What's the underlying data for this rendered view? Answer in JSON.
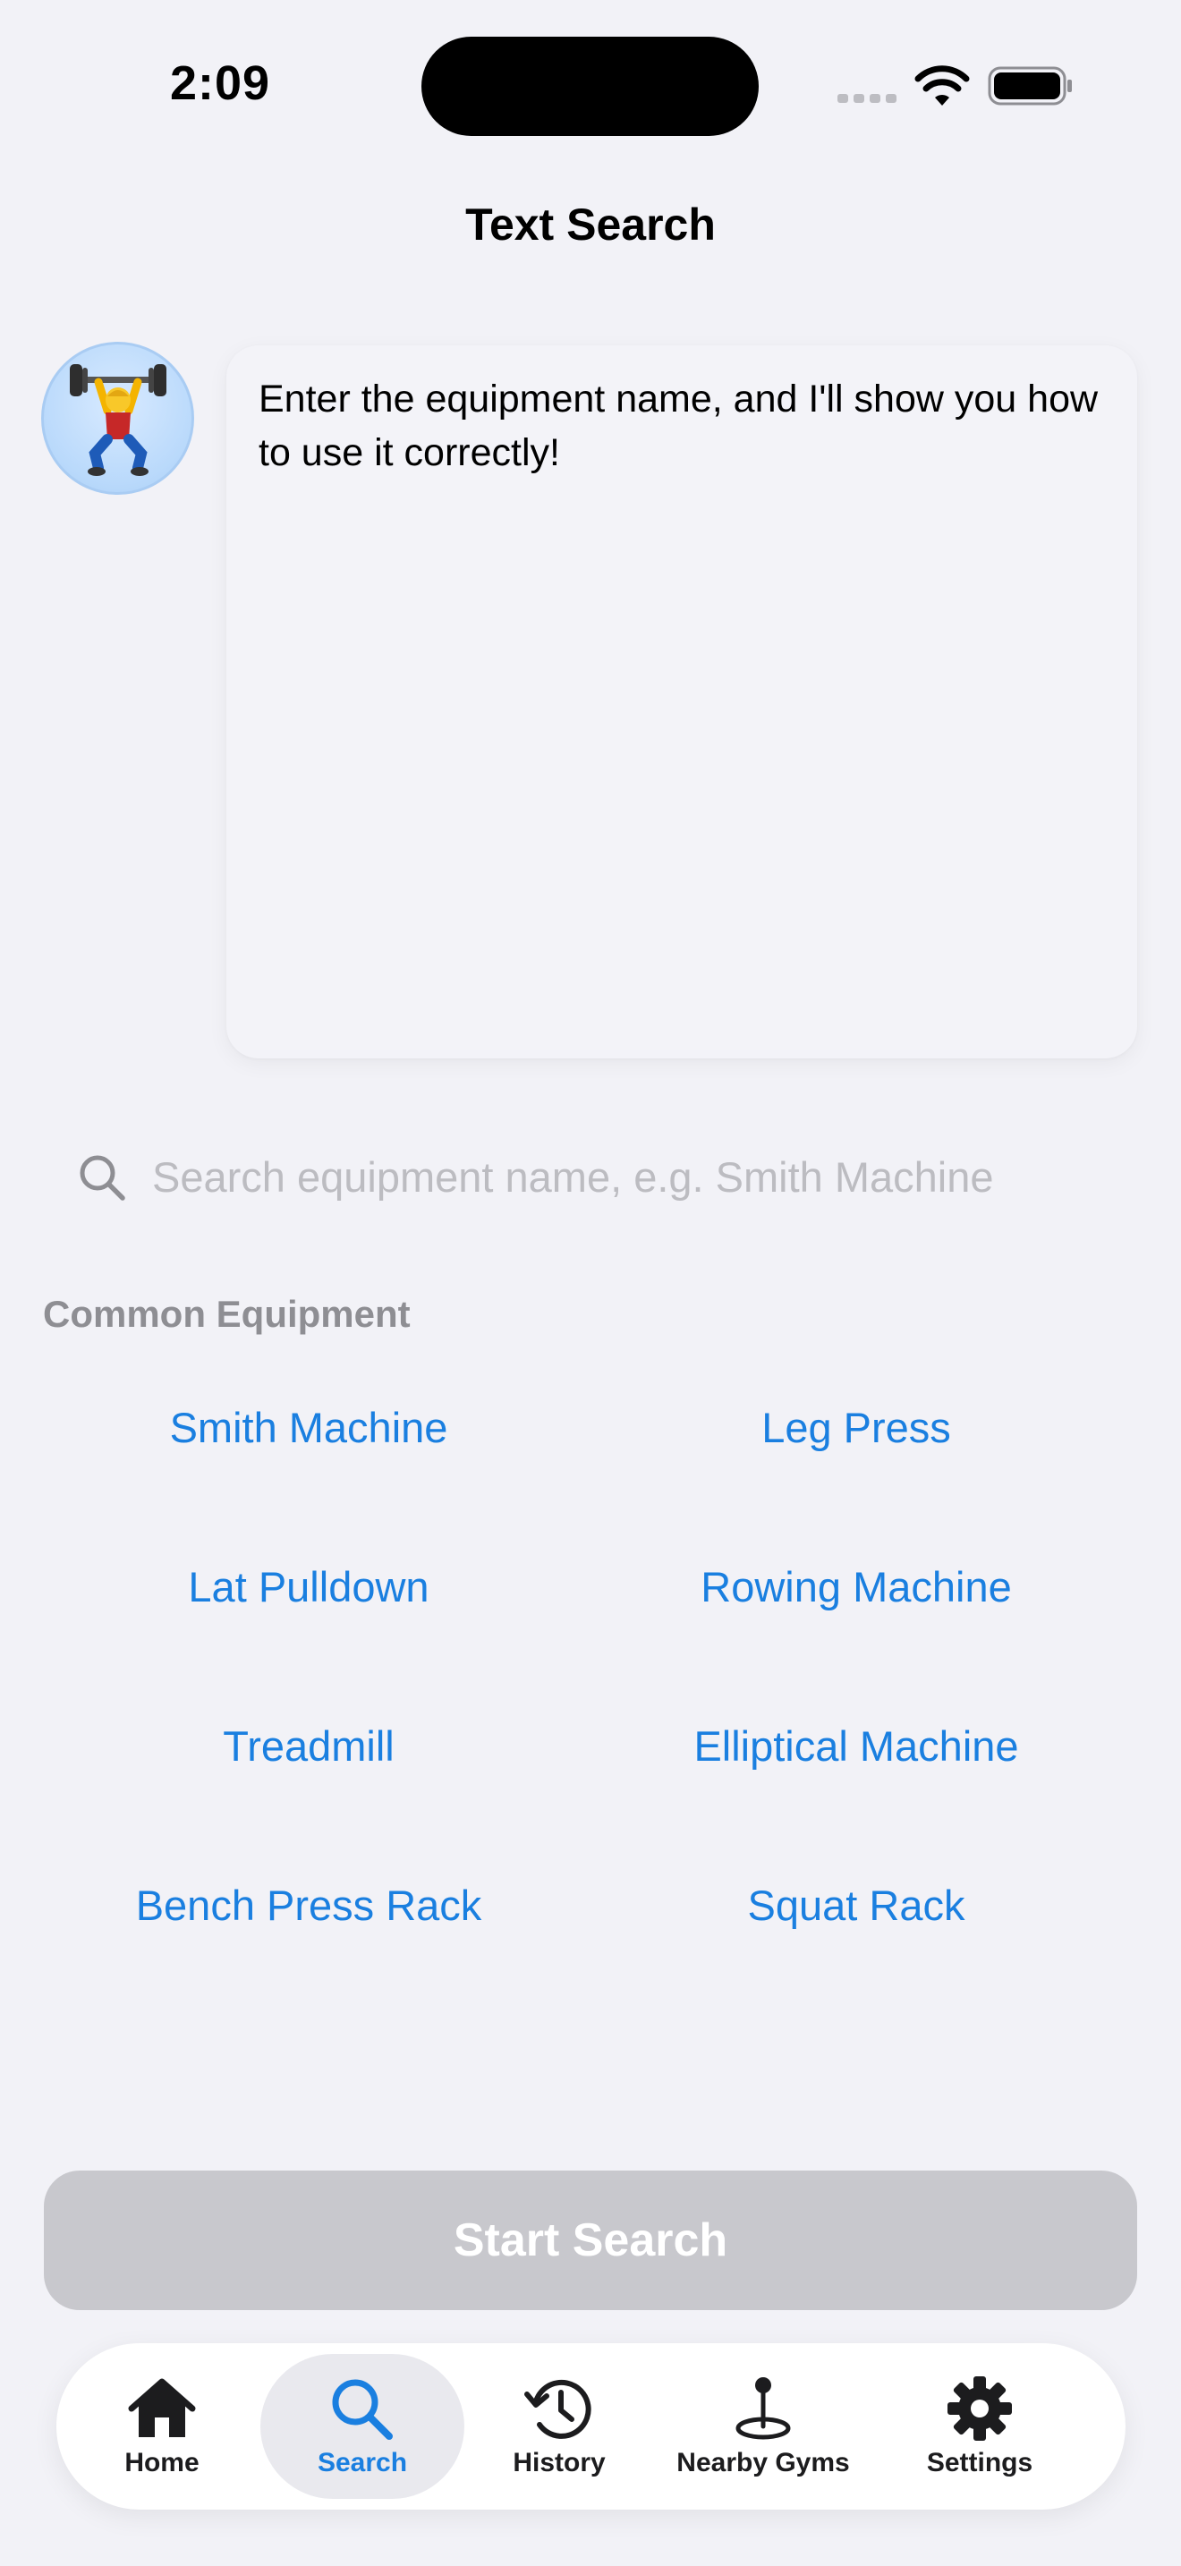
{
  "status_bar": {
    "time": "2:09"
  },
  "nav": {
    "title": "Text Search"
  },
  "assistant": {
    "avatar_icon": "person-lifting-weights-icon",
    "message": "Enter the equipment name, and I'll show you how to use it correctly!"
  },
  "search": {
    "placeholder": "Search equipment name, e.g. Smith Machine",
    "value": ""
  },
  "common_equipment": {
    "label": "Common Equipment",
    "items": [
      "Smith Machine",
      "Leg Press",
      "Lat Pulldown",
      "Rowing Machine",
      "Treadmill",
      "Elliptical Machine",
      "Bench Press Rack",
      "Squat Rack"
    ]
  },
  "start_button": {
    "label": "Start Search",
    "enabled": false
  },
  "tab_bar": {
    "active": "Search",
    "tabs": [
      {
        "label": "Home",
        "icon": "house-icon"
      },
      {
        "label": "Search",
        "icon": "magnifying-glass-icon"
      },
      {
        "label": "History",
        "icon": "clock-history-icon"
      },
      {
        "label": "Nearby Gyms",
        "icon": "location-pin-icon"
      },
      {
        "label": "Settings",
        "icon": "gear-icon"
      }
    ]
  },
  "colors": {
    "background": "#F2F2F7",
    "accent": "#1A7FE0",
    "secondary_label": "#8E8E93",
    "disabled_button": "#C8C8CD"
  }
}
